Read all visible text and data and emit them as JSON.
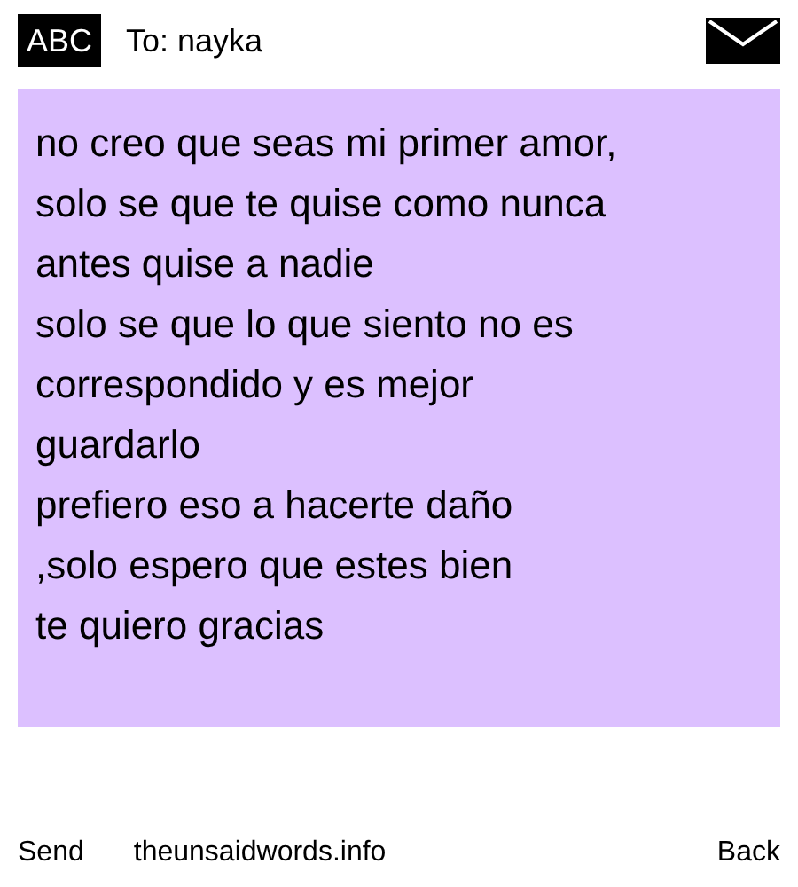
{
  "header": {
    "badge": "ABC",
    "recipient": "To: nayka"
  },
  "message": {
    "lines": [
      "no creo que seas mi primer amor,",
      "solo se que te quise como nunca",
      "antes quise a nadie",
      "solo se que lo que siento no es",
      "correspondido y es mejor",
      "guardarlo",
      "prefiero eso a hacerte daño",
      ",solo espero que estes bien",
      "te quiero gracias"
    ]
  },
  "footer": {
    "send": "Send",
    "site": "theunsaidwords.info",
    "back": "Back"
  }
}
